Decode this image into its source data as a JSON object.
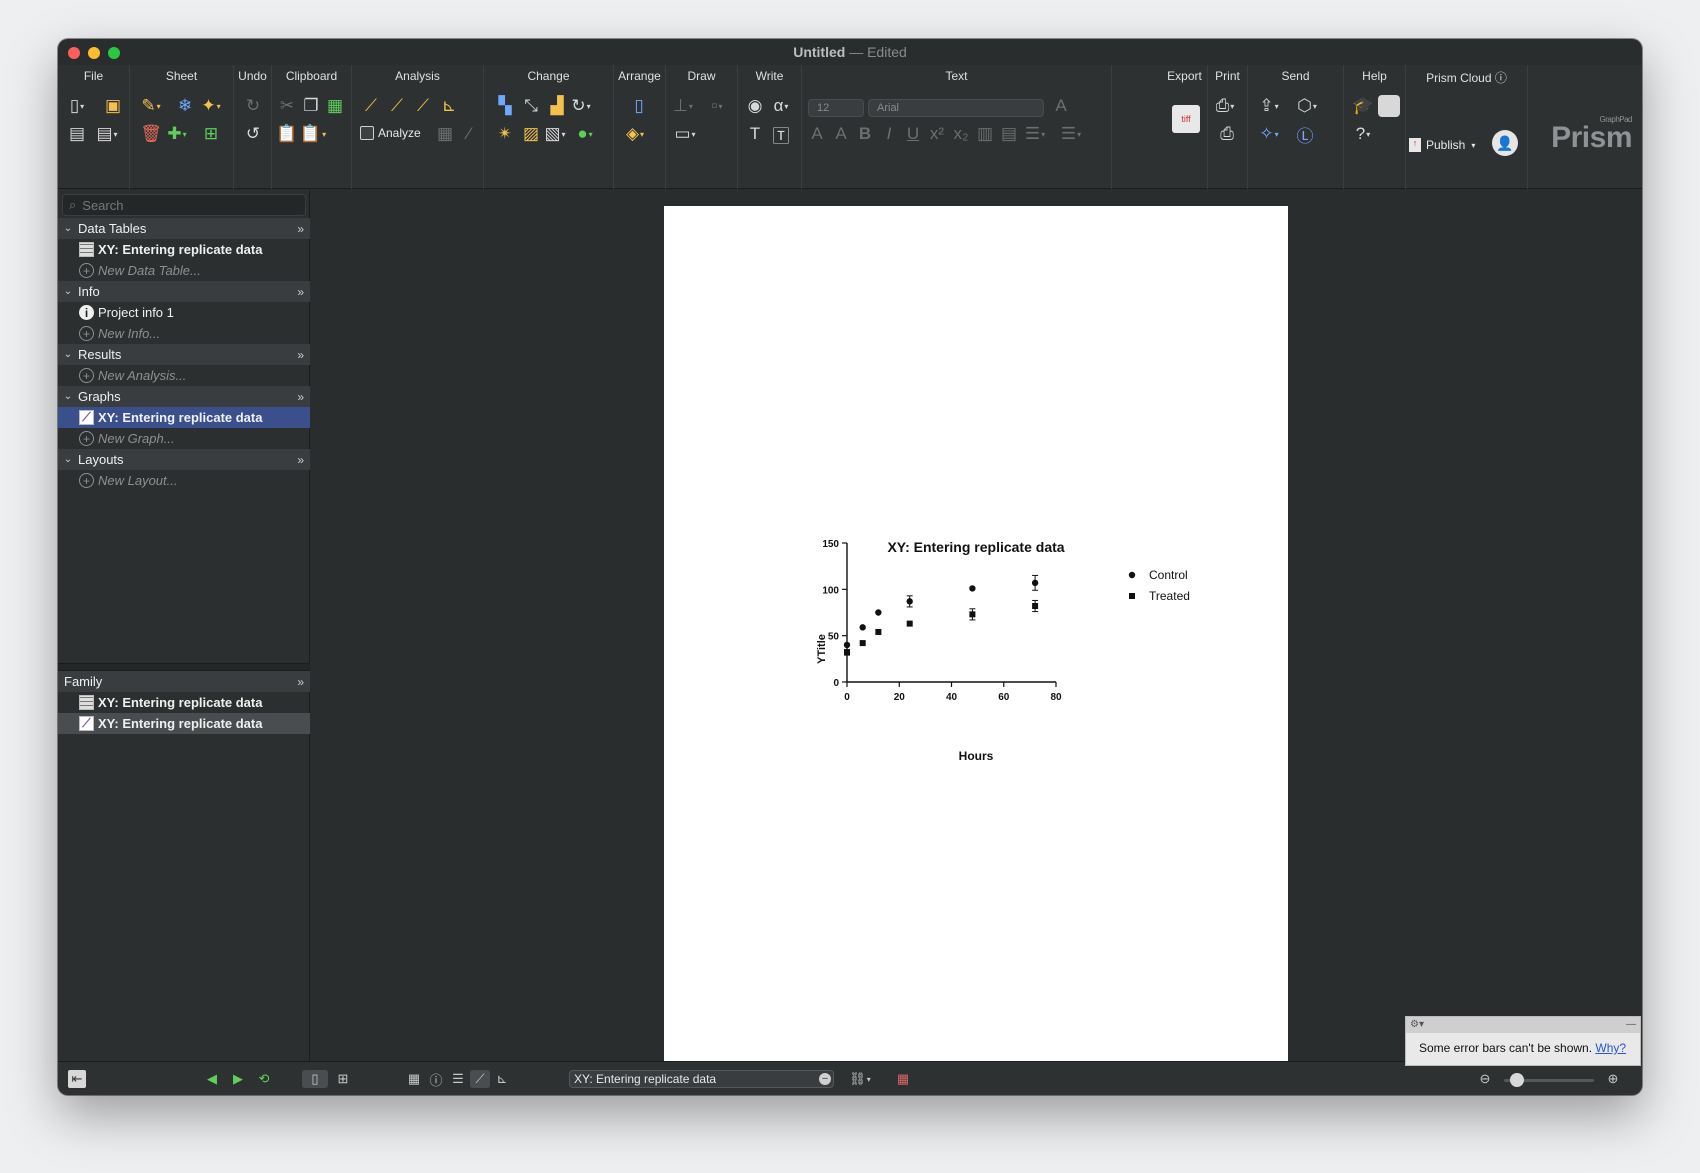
{
  "window": {
    "title": "Untitled",
    "status": "Edited"
  },
  "toolbar": {
    "groups": {
      "file": "File",
      "sheet": "Sheet",
      "undo": "Undo",
      "clipboard": "Clipboard",
      "analysis": "Analysis",
      "change": "Change",
      "arrange": "Arrange",
      "draw": "Draw",
      "write": "Write",
      "text": "Text",
      "export": "Export",
      "print": "Print",
      "send": "Send",
      "help": "Help",
      "prism_cloud": "Prism Cloud"
    },
    "analyze_label": "Analyze",
    "font_size": "12",
    "font_name": "Arial",
    "publish_label": "Publish",
    "logo": "Prism",
    "logo_small": "GraphPad"
  },
  "sidebar": {
    "search_placeholder": "Search",
    "data_tables": {
      "label": "Data Tables",
      "items": [
        "XY: Entering replicate data"
      ],
      "new": "New Data Table..."
    },
    "info": {
      "label": "Info",
      "items": [
        "Project info 1"
      ],
      "new": "New Info..."
    },
    "results": {
      "label": "Results",
      "new": "New Analysis..."
    },
    "graphs": {
      "label": "Graphs",
      "items": [
        "XY: Entering replicate data"
      ],
      "new": "New Graph..."
    },
    "layouts": {
      "label": "Layouts",
      "new": "New Layout..."
    },
    "family": {
      "label": "Family",
      "items": [
        "XY: Entering replicate data",
        "XY: Entering replicate data"
      ]
    }
  },
  "statusbar": {
    "sheet_name": "XY: Entering replicate data"
  },
  "notice": {
    "message": "Some error bars can't be shown.",
    "link": "Why?"
  },
  "chart_data": {
    "type": "scatter",
    "title": "XY: Entering replicate data",
    "xlabel": "Hours",
    "ylabel": "YTitle",
    "xlim": [
      0,
      80
    ],
    "ylim": [
      0,
      150
    ],
    "xticks": [
      0,
      20,
      40,
      60,
      80
    ],
    "yticks": [
      0,
      50,
      100,
      150
    ],
    "legend_position": "top-right",
    "series": [
      {
        "name": "Control",
        "marker": "circle",
        "x": [
          0,
          6,
          12,
          24,
          48,
          72
        ],
        "y": [
          40,
          59,
          75,
          87,
          101,
          107
        ],
        "err": [
          0,
          0,
          0,
          6,
          0,
          8
        ]
      },
      {
        "name": "Treated",
        "marker": "square",
        "x": [
          0,
          6,
          12,
          24,
          48,
          72
        ],
        "y": [
          32,
          42,
          54,
          63,
          73,
          82
        ],
        "err": [
          3,
          0,
          0,
          0,
          6,
          6
        ]
      }
    ]
  }
}
